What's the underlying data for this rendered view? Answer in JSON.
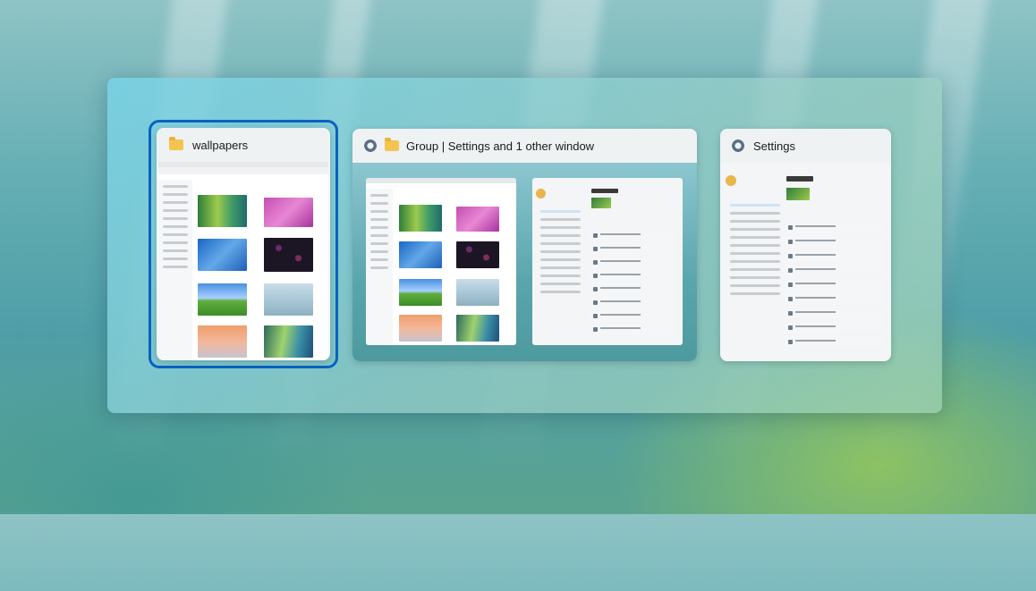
{
  "task_switcher": {
    "windows": [
      {
        "title": "wallpapers",
        "icon": "folder-icon",
        "selected": true
      },
      {
        "title": "Group | Settings and 1 other window",
        "icons": [
          "gear-icon",
          "folder-icon"
        ],
        "selected": false
      },
      {
        "title": "Settings",
        "icon": "gear-icon",
        "selected": false
      }
    ]
  },
  "colors": {
    "focus_ring": "#0a62c0",
    "folder": "#f3c44f",
    "gear": "#5a6e86"
  }
}
